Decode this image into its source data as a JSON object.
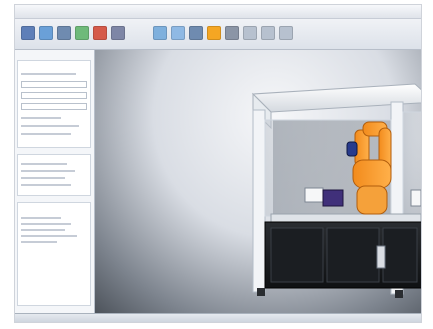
{
  "window": {
    "title": ""
  },
  "toolbar": {
    "buttons": [
      {
        "name": "select-tool-icon",
        "color": "#5e7fb8"
      },
      {
        "name": "move-tool-icon",
        "color": "#6aa0d8"
      },
      {
        "name": "rotate-tool-icon",
        "color": "#6f8bb0"
      },
      {
        "name": "play-icon",
        "color": "#6fba7a"
      },
      {
        "name": "record-icon",
        "color": "#d55a4a"
      },
      {
        "name": "camera-icon",
        "color": "#7e86a6"
      },
      {
        "name": "robot-icon",
        "color": "#f5a623"
      },
      {
        "name": "settings-icon",
        "color": "#8b95a6"
      }
    ]
  },
  "sidebar": {
    "panels": [
      {
        "title": "",
        "type": "properties"
      },
      {
        "title": "",
        "type": "list"
      }
    ]
  },
  "viewport": {
    "scene": "robot-cell",
    "robot_color": "#f28b1c"
  },
  "statusbar": {
    "items": [
      "",
      "",
      ""
    ]
  }
}
